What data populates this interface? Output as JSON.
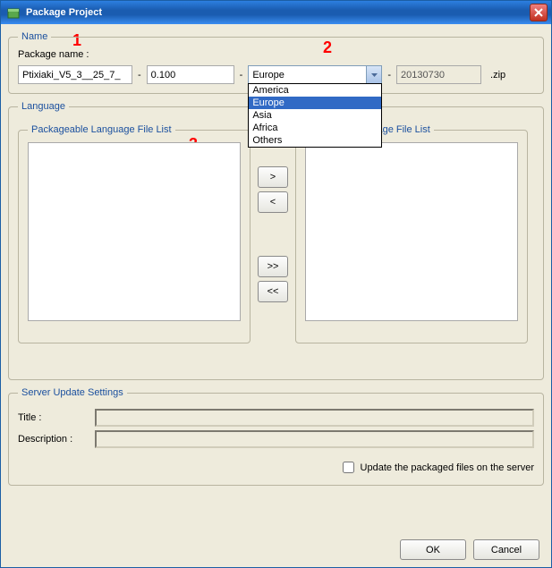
{
  "window": {
    "title": "Package Project"
  },
  "annotations": {
    "a1": "1",
    "a2": "2",
    "a3": "3"
  },
  "name": {
    "legend": "Name",
    "label": "Package name :",
    "name_value": "Ptixiaki_V5_3__25_7_",
    "version_value": "0.100",
    "region_selected": "Europe",
    "region_options": [
      "America",
      "Europe",
      "Asia",
      "Africa",
      "Others"
    ],
    "date_value": "20130730",
    "extension": ".zip",
    "sep": "-"
  },
  "language": {
    "legend": "Language",
    "left_legend": "Packageable Language File List",
    "right_legend": "Selected Language File List",
    "btn_add": ">",
    "btn_remove": "<",
    "btn_add_all": ">>",
    "btn_remove_all": "<<"
  },
  "server": {
    "legend": "Server Update Settings",
    "title_label": "Title :",
    "title_value": "",
    "desc_label": "Description :",
    "desc_value": "",
    "checkbox_label": "Update the packaged files on the server"
  },
  "buttons": {
    "ok": "OK",
    "cancel": "Cancel"
  }
}
